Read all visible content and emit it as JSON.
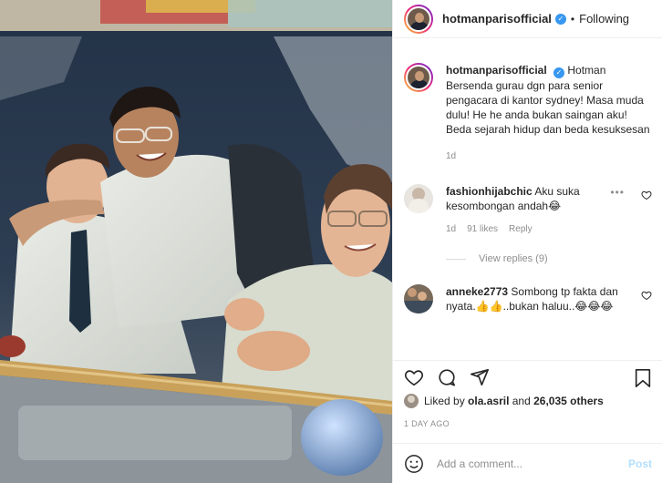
{
  "post": {
    "username": "hotmanparisofficial",
    "follow_state": "Following",
    "caption_text": "Hotman Bersenda gurau dgn para senior pengacara di kantor sydney! Masa muda dulu! He he anda bukan saingan aku! Beda sejarah hidup dan beda kesuksesan",
    "caption_time": "1d"
  },
  "comments": [
    {
      "username": "fashionhijabchic",
      "text": "Aku suka kesombongan andah😂",
      "time": "1d",
      "likes": "91 likes",
      "reply_label": "Reply",
      "view_replies": "View replies (9)"
    },
    {
      "username": "anneke2773",
      "text": "Sombong tp fakta dan nyata.👍👍..bukan haluu..😂😂😂"
    }
  ],
  "engagement": {
    "liked_by_prefix": "Liked by",
    "liked_by_user": "ola.asril",
    "and_label": "and",
    "others_label": "26,035 others",
    "posted_ago": "1 DAY AGO"
  },
  "composer": {
    "placeholder": "Add a comment...",
    "post_label": "Post"
  },
  "icons": [
    "heart-icon",
    "comment-icon",
    "share-icon",
    "bookmark-icon",
    "emoji-icon",
    "verified-badge-icon",
    "more-icon"
  ],
  "colors": {
    "verified": "#3897f0",
    "muted": "#8e8e8e",
    "post_disabled": "#b2dffc"
  }
}
